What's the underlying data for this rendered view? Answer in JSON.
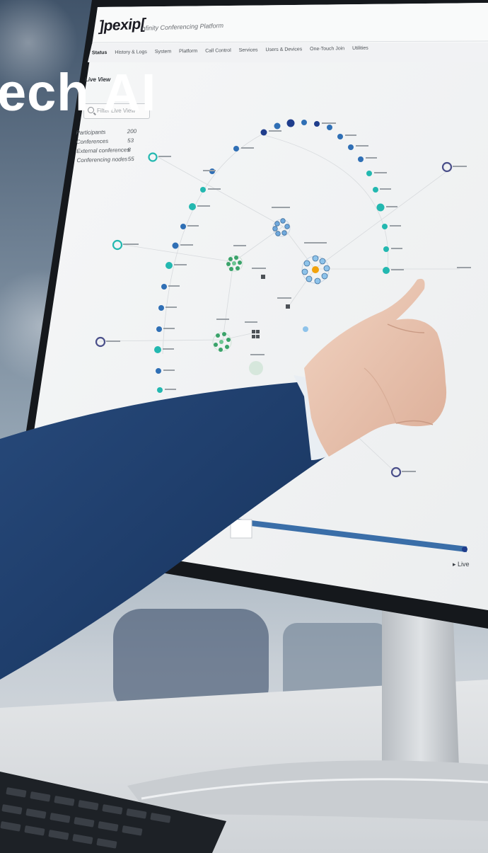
{
  "overlay": {
    "headline": "ech AI"
  },
  "screen": {
    "logo": "]pexip[",
    "tagline": "Infinity Conferencing Platform",
    "menu": [
      "Status",
      "History & Logs",
      "System",
      "Platform",
      "Call Control",
      "Services",
      "Users & Devices",
      "One-Touch Join",
      "Utilities"
    ],
    "view_title": "Live View",
    "filter_placeholder": "Filter Live View",
    "stats": [
      {
        "label": "Participants",
        "value": "200"
      },
      {
        "label": "Conferences",
        "value": "53"
      },
      {
        "label": "External conferences",
        "value": "8"
      },
      {
        "label": "Conferencing nodes",
        "value": "55"
      }
    ],
    "live_button": "▸ Live",
    "colors": {
      "teal_node": "#23b8b0",
      "blue_node": "#2f6fb5",
      "navy_node": "#1f3d8c",
      "green_cluster": "#3aa36a",
      "cluster_blue": "#6fa8dc",
      "orange_center": "#f2a20c",
      "sleeve": "#1d3d6b"
    }
  }
}
